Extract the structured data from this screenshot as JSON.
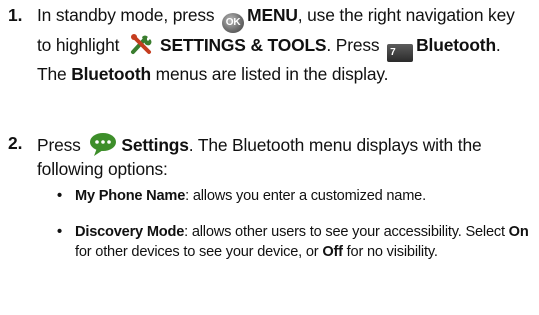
{
  "icons": {
    "ok_key": "OK",
    "seven_key": "7"
  },
  "steps": [
    {
      "number": "1.",
      "t1": "In standby mode, press ",
      "b1": "MENU",
      "t2": ", use the right navigation key to highlight ",
      "b2": "SETTINGS & TOOLS",
      "t3": ". Press ",
      "b3": "Bluetooth",
      "t4": ". The ",
      "b4": "Bluetooth",
      "t5": " menus are listed in the display."
    },
    {
      "number": "2.",
      "t1": "Press ",
      "b1": "Settings",
      "t2": ". The Bluetooth menu displays with the following options:"
    }
  ],
  "bullets": [
    {
      "marker": "•",
      "b1": "My Phone Name",
      "t1": ": allows you enter a customized name."
    },
    {
      "marker": "•",
      "b1": "Discovery Mode",
      "t1": ": allows other users to see your accessibility. Select ",
      "b2": "On",
      "t2": " for other devices to see your device, or ",
      "b3": "Off",
      "t3": " for no visibility."
    }
  ],
  "colors": {
    "text": "#111111",
    "icon_tools": "#3a7d2e"
  }
}
